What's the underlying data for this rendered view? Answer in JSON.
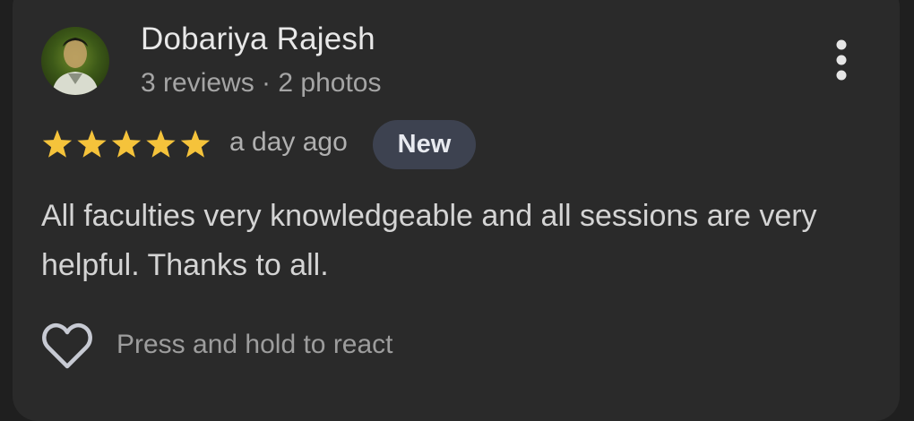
{
  "review": {
    "reviewer_name": "Dobariya Rajesh",
    "reviewer_meta": "3 reviews · 2 photos",
    "rating": 5,
    "rating_max": 5,
    "time": "a day ago",
    "badge": "New",
    "text": "All faculties very knowledgeable and all sessions are very helpful. Thanks to all."
  },
  "reaction": {
    "label": "Press and hold to react",
    "icon": "heart-outline-icon"
  },
  "icons": {
    "menu": "more-vertical-icon",
    "star": "star-icon",
    "avatar": "reviewer-avatar"
  },
  "colors": {
    "card_background": "#2a2a2a",
    "star": "#f5c33b",
    "badge_background": "#3d4250"
  }
}
